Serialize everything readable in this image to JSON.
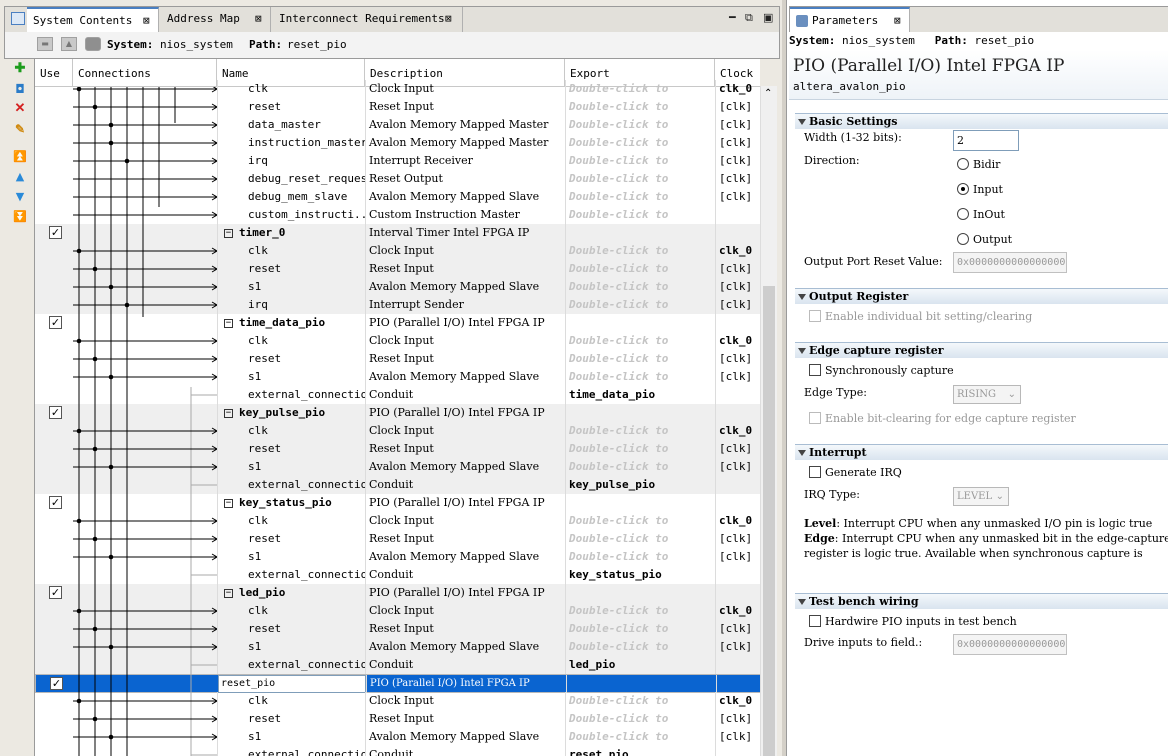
{
  "tabs": [
    {
      "label": "System Contents"
    },
    {
      "label": "Address Map"
    },
    {
      "label": "Interconnect Requirements"
    }
  ],
  "params_tab": {
    "label": "Parameters"
  },
  "system_bar": {
    "system_label": "System:",
    "system_value": "nios_system",
    "path_label": "Path:",
    "path_value": "reset_pio"
  },
  "columns": {
    "use": "Use",
    "connections": "Connections",
    "name": "Name",
    "description": "Description",
    "export": "Export",
    "clock": "Clock"
  },
  "rows": [
    {
      "kind": "sub",
      "name": "clk",
      "desc": "Clock Input",
      "export": "Double-click to",
      "clock": "clk_0"
    },
    {
      "kind": "sub",
      "name": "reset",
      "desc": "Reset Input",
      "export": "Double-click to",
      "clock": "[clk]"
    },
    {
      "kind": "sub",
      "name": "data_master",
      "desc": "Avalon Memory Mapped Master",
      "export": "Double-click to",
      "clock": "[clk]"
    },
    {
      "kind": "sub",
      "name": "instruction_master",
      "desc": "Avalon Memory Mapped Master",
      "export": "Double-click to",
      "clock": "[clk]"
    },
    {
      "kind": "sub",
      "name": "irq",
      "desc": "Interrupt Receiver",
      "export": "Double-click to",
      "clock": "[clk]"
    },
    {
      "kind": "sub",
      "name": "debug_reset_request",
      "desc": "Reset Output",
      "export": "Double-click to",
      "clock": "[clk]"
    },
    {
      "kind": "sub",
      "name": "debug_mem_slave",
      "desc": "Avalon Memory Mapped Slave",
      "export": "Double-click to",
      "clock": "[clk]"
    },
    {
      "kind": "sub",
      "name": "custom_instructi...",
      "desc": "Custom Instruction Master",
      "export": "Double-click to",
      "clock": ""
    },
    {
      "kind": "comp",
      "name": "timer_0",
      "desc": "Interval Timer Intel FPGA IP",
      "export": "",
      "clock": ""
    },
    {
      "kind": "sub",
      "name": "clk",
      "desc": "Clock Input",
      "export": "Double-click to",
      "clock": "clk_0"
    },
    {
      "kind": "sub",
      "name": "reset",
      "desc": "Reset Input",
      "export": "Double-click to",
      "clock": "[clk]"
    },
    {
      "kind": "sub",
      "name": "s1",
      "desc": "Avalon Memory Mapped Slave",
      "export": "Double-click to",
      "clock": "[clk]"
    },
    {
      "kind": "sub",
      "name": "irq",
      "desc": "Interrupt Sender",
      "export": "Double-click to",
      "clock": "[clk]"
    },
    {
      "kind": "comp",
      "name": "time_data_pio",
      "desc": "PIO (Parallel I/O) Intel FPGA IP",
      "export": "",
      "clock": ""
    },
    {
      "kind": "sub",
      "name": "clk",
      "desc": "Clock Input",
      "export": "Double-click to",
      "clock": "clk_0"
    },
    {
      "kind": "sub",
      "name": "reset",
      "desc": "Reset Input",
      "export": "Double-click to",
      "clock": "[clk]"
    },
    {
      "kind": "sub",
      "name": "s1",
      "desc": "Avalon Memory Mapped Slave",
      "export": "Double-click to",
      "clock": "[clk]"
    },
    {
      "kind": "conduit",
      "name": "external_connection",
      "desc": "Conduit",
      "export": "time_data_pio",
      "clock": ""
    },
    {
      "kind": "comp",
      "name": "key_pulse_pio",
      "desc": "PIO (Parallel I/O) Intel FPGA IP",
      "export": "",
      "clock": ""
    },
    {
      "kind": "sub",
      "name": "clk",
      "desc": "Clock Input",
      "export": "Double-click to",
      "clock": "clk_0"
    },
    {
      "kind": "sub",
      "name": "reset",
      "desc": "Reset Input",
      "export": "Double-click to",
      "clock": "[clk]"
    },
    {
      "kind": "sub",
      "name": "s1",
      "desc": "Avalon Memory Mapped Slave",
      "export": "Double-click to",
      "clock": "[clk]"
    },
    {
      "kind": "conduit",
      "name": "external_connection",
      "desc": "Conduit",
      "export": "key_pulse_pio",
      "clock": ""
    },
    {
      "kind": "comp",
      "name": "key_status_pio",
      "desc": "PIO (Parallel I/O) Intel FPGA IP",
      "export": "",
      "clock": ""
    },
    {
      "kind": "sub",
      "name": "clk",
      "desc": "Clock Input",
      "export": "Double-click to",
      "clock": "clk_0"
    },
    {
      "kind": "sub",
      "name": "reset",
      "desc": "Reset Input",
      "export": "Double-click to",
      "clock": "[clk]"
    },
    {
      "kind": "sub",
      "name": "s1",
      "desc": "Avalon Memory Mapped Slave",
      "export": "Double-click to",
      "clock": "[clk]"
    },
    {
      "kind": "conduit",
      "name": "external_connection",
      "desc": "Conduit",
      "export": "key_status_pio",
      "clock": ""
    },
    {
      "kind": "comp",
      "name": "led_pio",
      "desc": "PIO (Parallel I/O) Intel FPGA IP",
      "export": "",
      "clock": ""
    },
    {
      "kind": "sub",
      "name": "clk",
      "desc": "Clock Input",
      "export": "Double-click to",
      "clock": "clk_0"
    },
    {
      "kind": "sub",
      "name": "reset",
      "desc": "Reset Input",
      "export": "Double-click to",
      "clock": "[clk]"
    },
    {
      "kind": "sub",
      "name": "s1",
      "desc": "Avalon Memory Mapped Slave",
      "export": "Double-click to",
      "clock": "[clk]"
    },
    {
      "kind": "conduit",
      "name": "external_connection",
      "desc": "Conduit",
      "export": "led_pio",
      "clock": ""
    },
    {
      "kind": "selected",
      "name": "reset_pio",
      "desc": "PIO (Parallel I/O) Intel FPGA IP",
      "export": "",
      "clock": ""
    },
    {
      "kind": "sub",
      "name": "clk",
      "desc": "Clock Input",
      "export": "Double-click to",
      "clock": "clk_0"
    },
    {
      "kind": "sub",
      "name": "reset",
      "desc": "Reset Input",
      "export": "Double-click to",
      "clock": "[clk]"
    },
    {
      "kind": "sub",
      "name": "s1",
      "desc": "Avalon Memory Mapped Slave",
      "export": "Double-click to",
      "clock": "[clk]"
    },
    {
      "kind": "conduit",
      "name": "external_connection",
      "desc": "Conduit",
      "export": "reset_pio",
      "clock": ""
    }
  ],
  "params": {
    "system_line": "System: nios_system   Path: reset_pio",
    "title": "PIO (Parallel I/O) Intel FPGA IP",
    "subtitle": "altera_avalon_pio",
    "basic": {
      "header": "Basic Settings",
      "width_label": "Width (1-32 bits):",
      "width_value": "2",
      "direction_label": "Direction:",
      "dir_options": [
        "Bidir",
        "Input",
        "InOut",
        "Output"
      ],
      "dir_selected": "Input",
      "reset_label": "Output Port Reset Value:",
      "reset_value": "0x0000000000000000"
    },
    "output_register": {
      "header": "Output Register",
      "option": "Enable individual bit setting/clearing"
    },
    "edge_capture": {
      "header": "Edge capture register",
      "sync": "Synchronously capture",
      "edge_type_label": "Edge Type:",
      "edge_type_value": "RISING",
      "bit_clear": "Enable bit-clearing for edge capture register"
    },
    "interrupt": {
      "header": "Interrupt",
      "gen_irq": "Generate IRQ",
      "irq_type_label": "IRQ Type:",
      "irq_type_value": "LEVEL",
      "level_title": "Level",
      "level_text": ": Interrupt CPU when any unmasked I/O pin is logic true",
      "edge_title": "Edge",
      "edge_text": ": Interrupt CPU when any unmasked bit in the edge-capture",
      "edge_text2": "register is logic true. Available when synchronous capture is"
    },
    "testbench": {
      "header": "Test bench wiring",
      "hardwire": "Hardwire PIO inputs in test bench",
      "drive_label": "Drive inputs to field.:",
      "drive_value": "0x0000000000000000"
    }
  }
}
